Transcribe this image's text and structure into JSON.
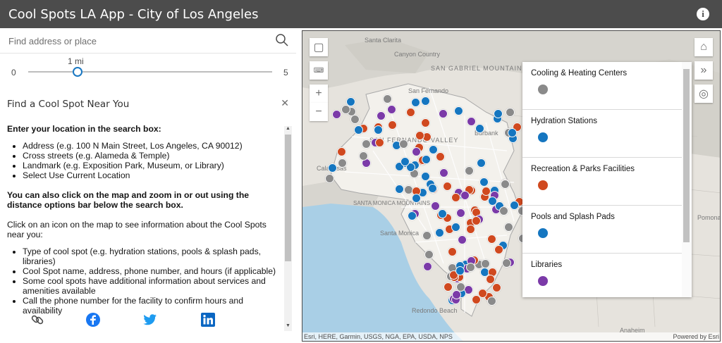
{
  "header": {
    "title": "Cool Spots LA App - City of Los Angeles",
    "info_icon": "info-icon"
  },
  "search": {
    "placeholder": "Find address or place"
  },
  "slider": {
    "value_label": "1 mi",
    "min_label": "0",
    "max_label": "5",
    "value": 1,
    "min": 0,
    "max": 5
  },
  "panel": {
    "title": "Find a Cool Spot Near You",
    "heading1": "Enter your location in the search box:",
    "list1": [
      "Address (e.g. 100 N Main Street, Los Angeles, CA 90012)",
      "Cross streets (e.g. Alameda & Temple)",
      "Landmark (e.g. Exposition Park, Museum, or Library)",
      "Select Use Current Location"
    ],
    "heading2": "You can also click on the map and zoom in or out using the distance options bar below the search box.",
    "para1": "Click on an icon on the map to see information about the Cool Spots near you:",
    "list2": [
      "Type of cool spot (e.g. hydration stations, pools & splash pads, libraries)",
      "Cool Spot name, address, phone number, and hours (if applicable)",
      "Some cool spots have additional information about services and amenities available",
      "Call the phone number for the facility to confirm hours and availability"
    ]
  },
  "social": [
    "link-icon",
    "facebook-icon",
    "twitter-icon",
    "linkedin-icon"
  ],
  "map": {
    "labels": [
      "Santa Clarita",
      "Canyon Country",
      "SAN GABRIEL MOUNTAINS",
      "San Fernando",
      "SAN FERNANDO VALLEY",
      "Burbank",
      "Calabasas",
      "Santa Monica",
      "Redondo Beach",
      "Anaheim",
      "Pomona",
      "SANTA MONICA MOUNTAINS"
    ],
    "attribution": "Esri, HERE, Garmin, USGS, NGA, EPA, USDA, NPS",
    "powered_by": "Powered by Esri",
    "legend": [
      {
        "label": "Cooling & Heating Centers",
        "color": "#8a8a8a"
      },
      {
        "label": "Hydration Stations",
        "color": "#1576c0"
      },
      {
        "label": "Recreation & Parks Facilities",
        "color": "#d0491f"
      },
      {
        "label": "Pools and Splash Pads",
        "color": "#1576c0"
      },
      {
        "label": "Libraries",
        "color": "#7b3aa8"
      }
    ]
  }
}
